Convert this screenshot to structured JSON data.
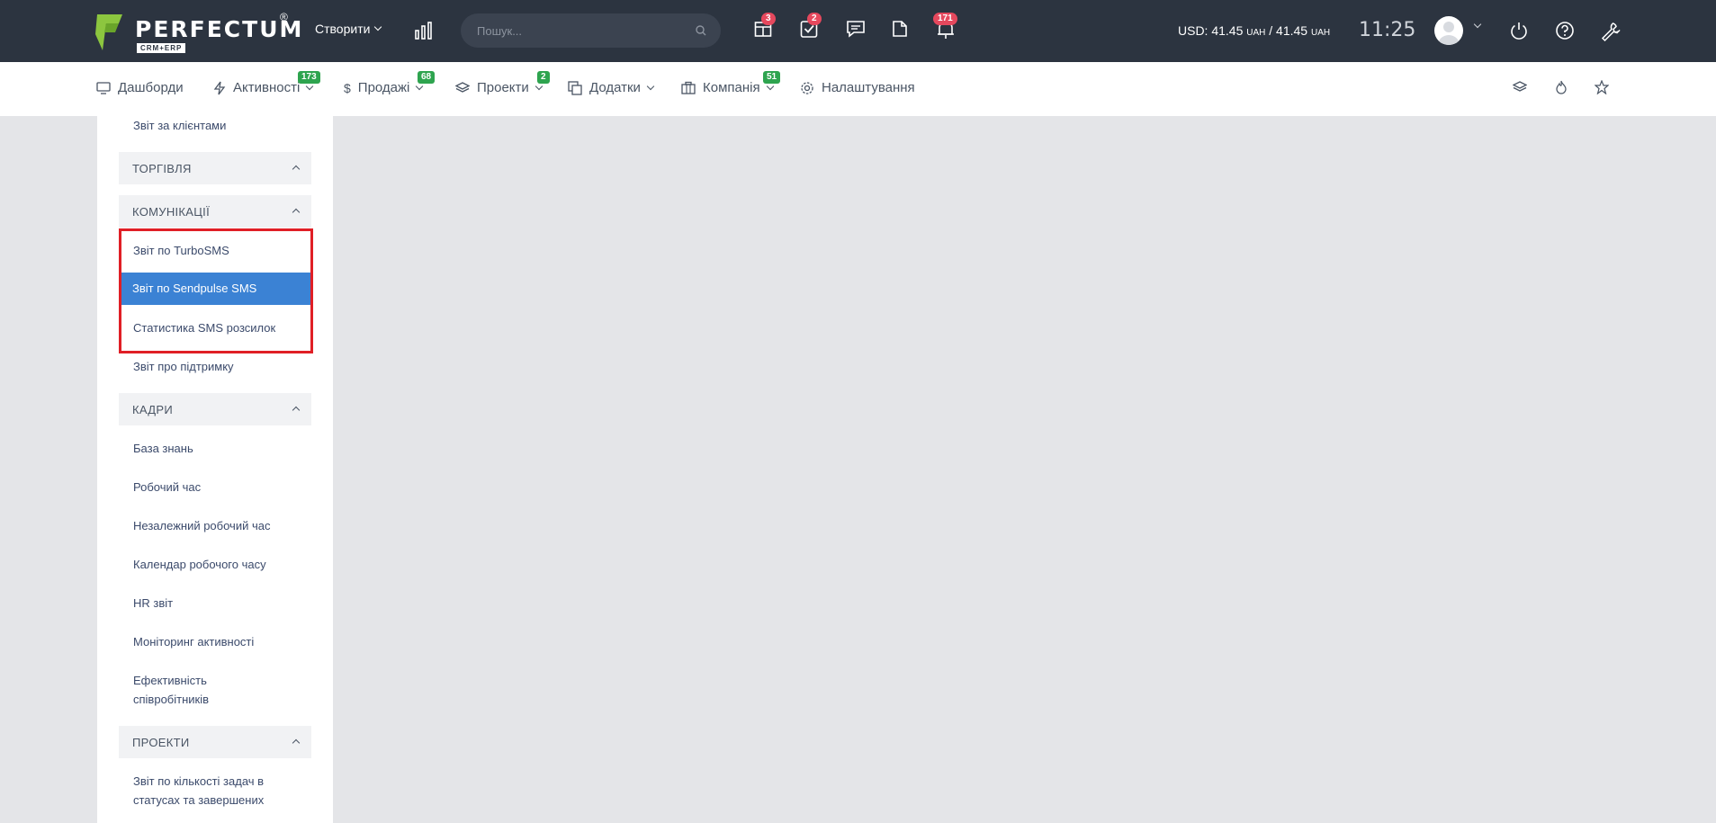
{
  "brand": {
    "name": "PERFECTUM",
    "registered": "®",
    "tagline": "CRM+ERP"
  },
  "topbar": {
    "create_label": "Створити",
    "search_placeholder": "Пошук...",
    "badges": {
      "deals": "3",
      "tasks": "2",
      "notifications": "171"
    },
    "currency_prefix": "USD: 41.45",
    "currency_unit1": "UAH",
    "currency_mid": " / 41.45",
    "currency_unit2": "UAH",
    "time": "11:25"
  },
  "nav": {
    "dashboards": "Дашборди",
    "activities": "Активності",
    "activities_badge": "173",
    "sales": "Продажі",
    "sales_badge": "68",
    "projects": "Проекти",
    "projects_badge": "2",
    "addons": "Додатки",
    "company": "Компанія",
    "company_badge": "51",
    "settings": "Налаштування"
  },
  "sidebar": {
    "client_report": "Звіт за клієнтами",
    "section_trade": "ТОРГІВЛЯ",
    "section_comms": "КОМУНІКАЦІЇ",
    "turbosms": "Звіт по TurboSMS",
    "sendpulse": "Звіт по Sendpulse SMS",
    "sms_stats": "Статистика SMS розсилок",
    "support_report": "Звіт про підтримку",
    "section_hr": "КАДРИ",
    "knowledge": "База знань",
    "work_time": "Робочий час",
    "indep_time": "Незалежний робочий час",
    "work_calendar": "Календар робочого часу",
    "hr_report": "HR звіт",
    "activity_monitor": "Моніторинг активності",
    "efficiency": "Ефективність співробітників",
    "section_projects": "ПРОЕКТИ",
    "tasks_report": "Звіт по кількості задач в статусах та завершених"
  },
  "colors": {
    "topbar": "#2c3440",
    "active": "#3b82d4",
    "highlight": "#e01f26",
    "badge_red": "#e5485d",
    "badge_green": "#2ea44f"
  }
}
